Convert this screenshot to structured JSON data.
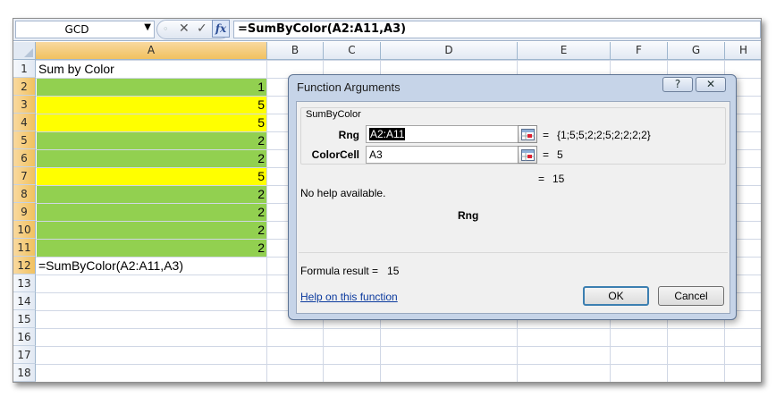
{
  "formula_bar": {
    "name_box": "GCD",
    "formula": "=SumByColor(A2:A11,A3)",
    "fx_label": "fx"
  },
  "columns": [
    "A",
    "B",
    "C",
    "D",
    "E",
    "F",
    "G",
    "H"
  ],
  "rows": [
    "1",
    "2",
    "3",
    "4",
    "5",
    "6",
    "7",
    "8",
    "9",
    "10",
    "11",
    "12",
    "13",
    "14",
    "15",
    "16",
    "17",
    "18"
  ],
  "cells": {
    "a1": "Sum by Color",
    "a2": "1",
    "a3": "5",
    "a4": "5",
    "a5": "2",
    "a6": "2",
    "a7": "5",
    "a8": "2",
    "a9": "2",
    "a10": "2",
    "a11": "2",
    "a12": "=SumByColor(A2:A11,A3)"
  },
  "colors": {
    "green_fill": "#92d050",
    "yellow_fill": "#ffff00",
    "selection_header": "#f1c15f"
  },
  "dialog": {
    "title": "Function Arguments",
    "help_btn": "?",
    "close_btn": "✕",
    "group_label": "SumByColor",
    "arg1_label": "Rng",
    "arg1_value": "A2:A11",
    "arg1_eq": "=",
    "arg1_result": "{1;5;5;2;2;5;2;2;2;2}",
    "arg2_label": "ColorCell",
    "arg2_value": "A3",
    "arg2_eq": "=",
    "arg2_result": "5",
    "total_eq": "=",
    "total_result": "15",
    "no_help": "No help available.",
    "current_arg": "Rng",
    "formula_result_label": "Formula result =",
    "formula_result_value": "15",
    "help_link": "Help on this function",
    "ok": "OK",
    "cancel": "Cancel"
  }
}
